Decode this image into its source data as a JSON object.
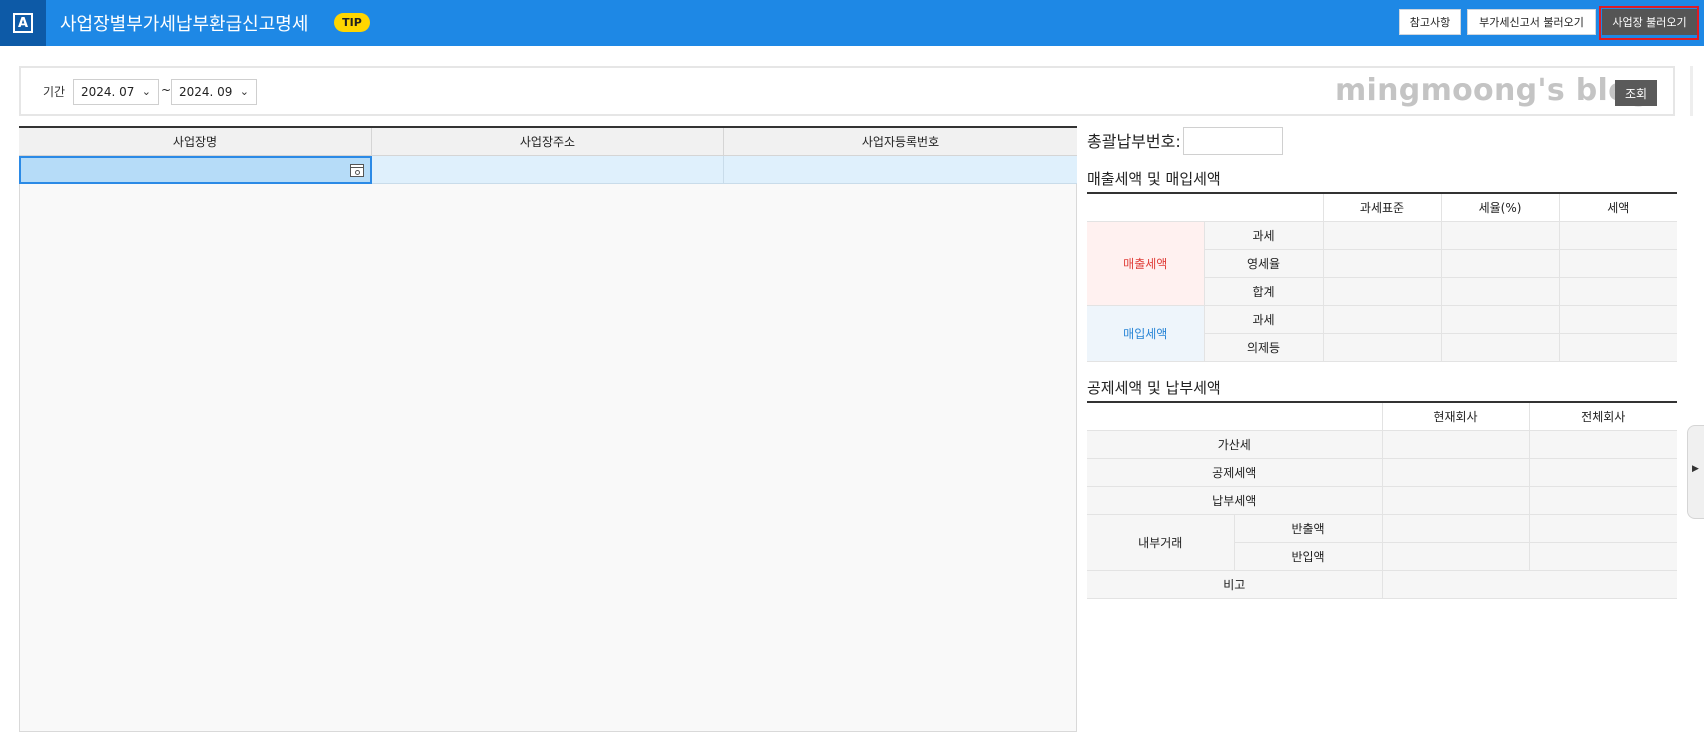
{
  "header": {
    "logo_letter": "A",
    "title": "사업장별부가세납부환급신고명세",
    "tip_badge": "TIP",
    "buttons": {
      "reference": "참고사항",
      "load_vat_return": "부가세신고서 불러오기",
      "load_business": "사업장 불러오기"
    }
  },
  "filter": {
    "period_label": "기간",
    "period_from": "2024. 07",
    "period_separator": "~",
    "period_to": "2024. 09",
    "watermark": "mingmoong's blog",
    "search_button": "조회"
  },
  "grid": {
    "columns": [
      "사업장명",
      "사업장주소",
      "사업자등록번호"
    ],
    "rows": [
      [
        "",
        "",
        ""
      ]
    ]
  },
  "right_panel": {
    "total_payment_label": "총괄납부번호:",
    "total_payment_value": "",
    "sales_purchase": {
      "title": "매출세액 및 매입세액",
      "headers": [
        "",
        "",
        "과세표준",
        "세율(%)",
        "세액"
      ],
      "sales_group": "매출세액",
      "sales_rows": [
        "과세",
        "영세율",
        "합계"
      ],
      "purchase_group": "매입세액",
      "purchase_rows": [
        "과세",
        "의제등"
      ]
    },
    "deduction_payment": {
      "title": "공제세액 및 납부세액",
      "headers": [
        "",
        "현재회사",
        "전체회사"
      ],
      "rows": [
        "가산세",
        "공제세액",
        "납부세액"
      ],
      "internal_group": "내부거래",
      "internal_rows": [
        "반출액",
        "반입액"
      ],
      "remarks": "비고"
    }
  },
  "colors": {
    "header_bg": "#1e88e5",
    "logo_bg": "#0d5aa7",
    "tip_badge": "#ffd600",
    "highlight_frame": "#e01b24",
    "sales_text": "#e0403a",
    "purchase_text": "#2a86d6"
  }
}
